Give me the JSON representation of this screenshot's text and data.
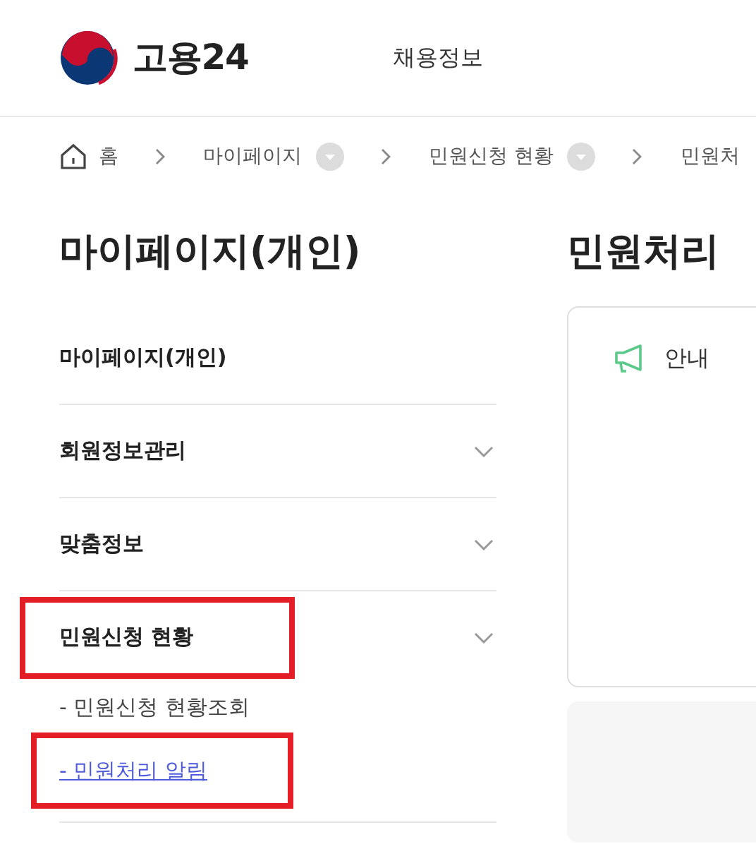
{
  "header": {
    "logo_text": "고용24",
    "nav": [
      "채용정보"
    ]
  },
  "breadcrumb": [
    {
      "label": "홈",
      "kind": "home"
    },
    {
      "label": "마이페이지",
      "kind": "dropdown"
    },
    {
      "label": "민원신청 현황",
      "kind": "dropdown"
    },
    {
      "label": "민원처",
      "kind": "plain"
    }
  ],
  "sidebar": {
    "title": "마이페이지(개인)",
    "items": [
      {
        "label": "마이페이지(개인)",
        "kind": "link",
        "highlighted": false
      },
      {
        "label": "회원정보관리",
        "kind": "group",
        "highlighted": false
      },
      {
        "label": "맞춤정보",
        "kind": "group",
        "highlighted": false
      },
      {
        "label": "민원신청 현황",
        "kind": "group",
        "highlighted": true,
        "children": [
          {
            "label": "- 민원신청 현황조회",
            "selected": false,
            "highlighted": false
          },
          {
            "label": "- 민원처리 알림",
            "selected": true,
            "highlighted": true
          }
        ]
      }
    ]
  },
  "main": {
    "title": "민원처리",
    "notice": {
      "label": "안내"
    }
  }
}
